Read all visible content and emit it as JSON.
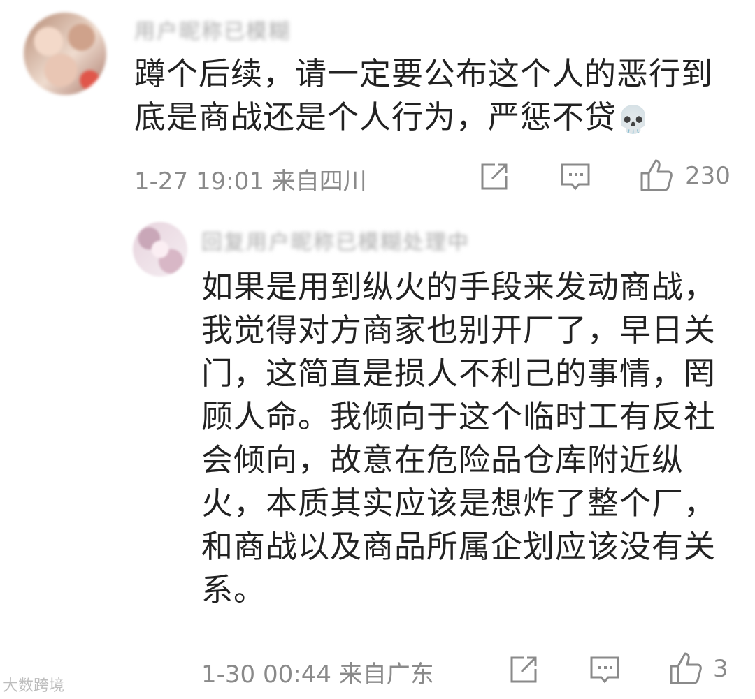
{
  "comments": [
    {
      "username": "用户昵称已模糊",
      "text": "蹲个后续，请一定要公布这个人的恶行到底是商战还是个人行为，严惩不贷",
      "emoji": "💀",
      "time": "1-27 19:01",
      "location": "来自四川",
      "likes": "230"
    },
    {
      "username": "回复用户昵称已模糊处理中",
      "text": "如果是用到纵火的手段来发动商战，我觉得对方商家也别开厂了，早日关门，这简直是损人不利己的事情，罔顾人命。我倾向于这个临时工有反社会倾向，故意在危险品仓库附近纵火，本质其实应该是想炸了整个厂，和商战以及商品所属企划应该没有关系。",
      "time": "1-30 00:44",
      "location": "来自广东",
      "likes": "3"
    }
  ],
  "icons": {
    "share": "share-icon",
    "comment": "comment-icon",
    "like": "thumbs-up-icon"
  },
  "watermark": "大数跨境",
  "colors": {
    "text": "#222222",
    "meta": "#8a8a8a"
  }
}
